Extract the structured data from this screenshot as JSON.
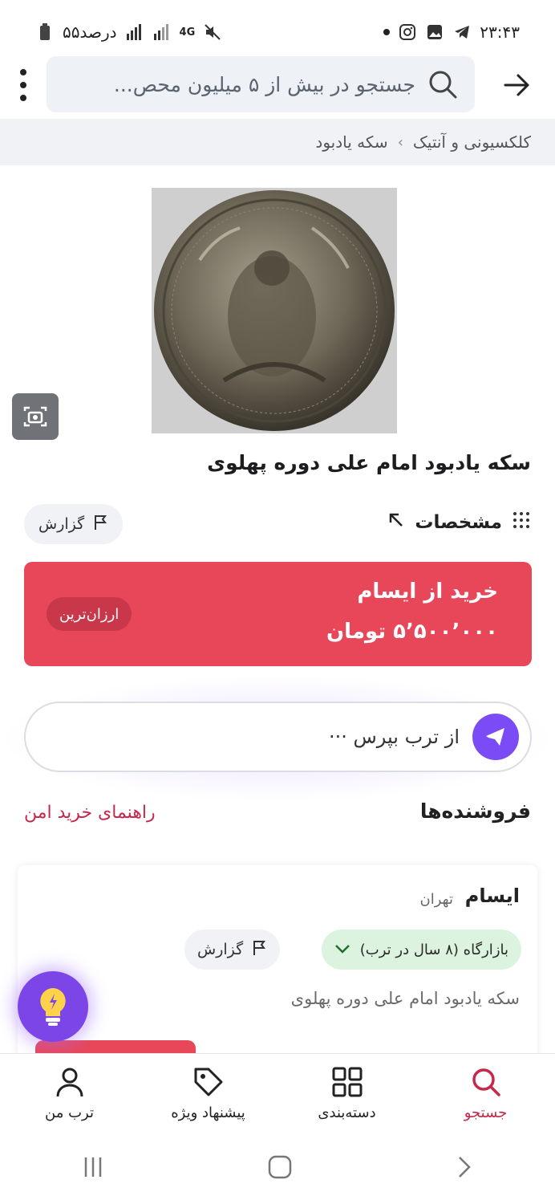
{
  "status_bar": {
    "time": "۲۳:۴۳",
    "battery": "۵۵درصد",
    "network": "4G"
  },
  "search": {
    "placeholder": "جستجو در بیش از ۵ میلیون محص..."
  },
  "breadcrumb": {
    "items": [
      "کلکسیونی و آنتیک",
      "سکه یادبود"
    ]
  },
  "product": {
    "title": "سکه یادبود امام علی دوره پهلوی",
    "specs_label": "مشخصات",
    "report_label": "گزارش"
  },
  "buy": {
    "title": "خرید از ایسام",
    "price": "۵٬۵۰۰٬۰۰۰ تومان",
    "badge": "ارزان‌ترین",
    "color": "#e8475a"
  },
  "ask": {
    "text": "از ترب بپرس ···"
  },
  "sellers": {
    "title": "فروشنده‌ها",
    "safe_guide": "راهنمای خرید امن",
    "items": [
      {
        "name": "ایسام",
        "city": "تهران",
        "badge": "بازارگاه (۸ سال در ترب)",
        "report_label": "گزارش",
        "product": "سکه یادبود امام علی دوره پهلوی"
      }
    ]
  },
  "bottom_nav": {
    "items": [
      {
        "label": "جستجو",
        "icon": "search-icon"
      },
      {
        "label": "دسته‌بندی",
        "icon": "grid-icon"
      },
      {
        "label": "پیشنهاد ویژه",
        "icon": "tag-icon"
      },
      {
        "label": "ترب من",
        "icon": "user-icon"
      }
    ]
  },
  "colors": {
    "accent": "#c6284a",
    "assistant": "#7b4bf5"
  }
}
